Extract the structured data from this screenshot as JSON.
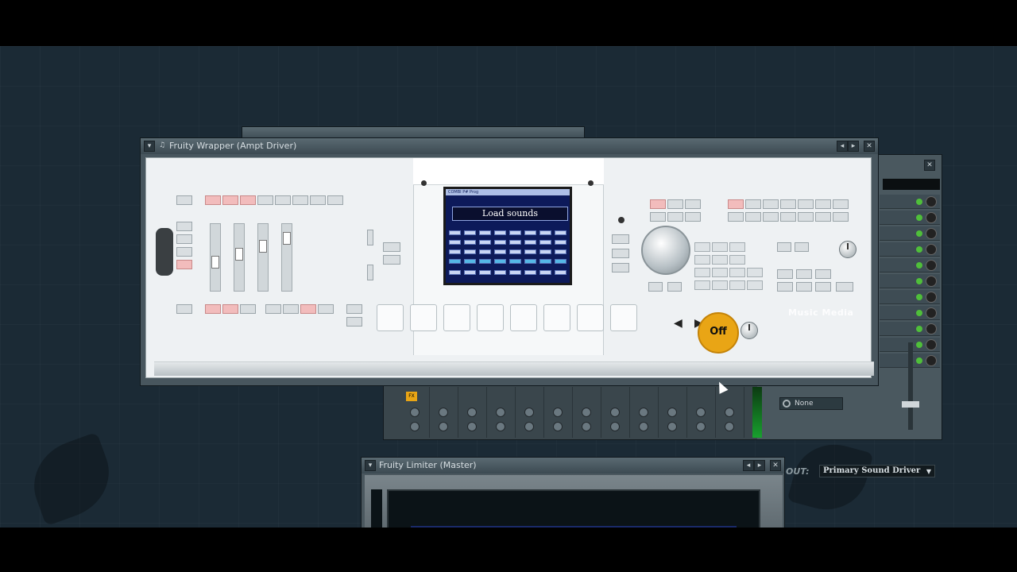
{
  "windows": {
    "wrapper": {
      "title": "Fruity Wrapper (Ampt Driver)"
    },
    "limiter": {
      "title": "Fruity Limiter (Master)"
    }
  },
  "synth": {
    "lcd_header": "COMBI  P# Prog",
    "lcd_dialog": "Load sounds",
    "power_label": "Off",
    "watermark": "Music Media"
  },
  "mixer": {
    "slot_label": "None",
    "out_label": "OUT:",
    "output_device": "Primary Sound Driver",
    "insert_badge": "FX"
  },
  "icons": {
    "close": "close-icon",
    "arrow_left": "arrow-left-icon",
    "arrow_right": "arrow-right-icon",
    "power_knob": "power-knob-icon"
  },
  "colors": {
    "desktop_bg": "#1b2a35",
    "window_bg": "#3a4a52",
    "synth_panel": "#eef1f3",
    "lcd_bg": "#0d1a5a",
    "power_button": "#e9a515",
    "meter_green": "#18a12e",
    "led_green": "#4fbf3a"
  }
}
